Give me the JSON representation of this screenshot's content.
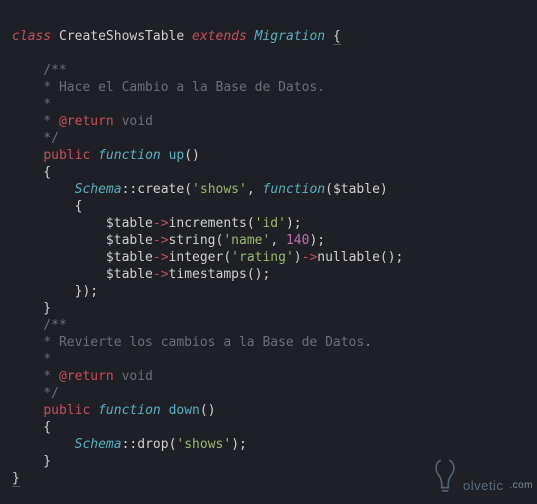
{
  "code": {
    "l1": {
      "kw": "class",
      "name": "CreateShowsTable",
      "ext": "extends",
      "mig": "Migration",
      "brace": "{"
    },
    "l2": "    /**",
    "l3": "    * Hace el Cambio a la Base de Datos.",
    "l4": "    *",
    "l5a": "    * ",
    "l5b": "@return",
    "l5c": " void",
    "l6": "    */",
    "l7": {
      "pub": "public",
      "fn": "function",
      "name": "up",
      "paren": "()"
    },
    "l8": "    {",
    "l9": {
      "indent": "        ",
      "sch": "Schema",
      "dblc": "::",
      "create": "create",
      "p1": "(",
      "s1": "'shows'",
      "c": ", ",
      "fn": "function",
      "p2": "(",
      "tbl": "$table",
      "p3": ")"
    },
    "l10": "        {",
    "l11": {
      "indent": "            ",
      "v": "$table",
      "arr": "->",
      "m": "increments",
      "p1": "(",
      "s": "'id'",
      "p2": ");"
    },
    "l12": {
      "indent": "            ",
      "v": "$table",
      "arr": "->",
      "m": "string",
      "p1": "(",
      "s": "'name'",
      "c": ", ",
      "n": "140",
      "p2": ");"
    },
    "l13": {
      "indent": "            ",
      "v": "$table",
      "arr": "->",
      "m": "integer",
      "p1": "(",
      "s": "'rating'",
      "p2": ")",
      "arr2": "->",
      "m2": "nullable",
      "p3": "();"
    },
    "l14": {
      "indent": "            ",
      "v": "$table",
      "arr": "->",
      "m": "timestamps",
      "p": "();"
    },
    "l15": "        });",
    "l16": "    }",
    "l17": "    /**",
    "l18": "    * Revierte los cambios a la Base de Datos",
    "l18dot": ".",
    "l19": "    *",
    "l20a": "    * ",
    "l20b": "@return",
    "l20c": " void",
    "l21": "    */",
    "l22": {
      "pub": "public",
      "fn": "function",
      "name": "down",
      "paren": "()"
    },
    "l23": "    {",
    "l24": {
      "indent": "        ",
      "sch": "Schema",
      "dblc": "::",
      "drop": "drop",
      "p1": "(",
      "s": "'shows'",
      "p2": ");"
    },
    "l25": "    }",
    "l26": "}"
  },
  "watermark": {
    "brand": "olvetic",
    "ext": ".com"
  }
}
